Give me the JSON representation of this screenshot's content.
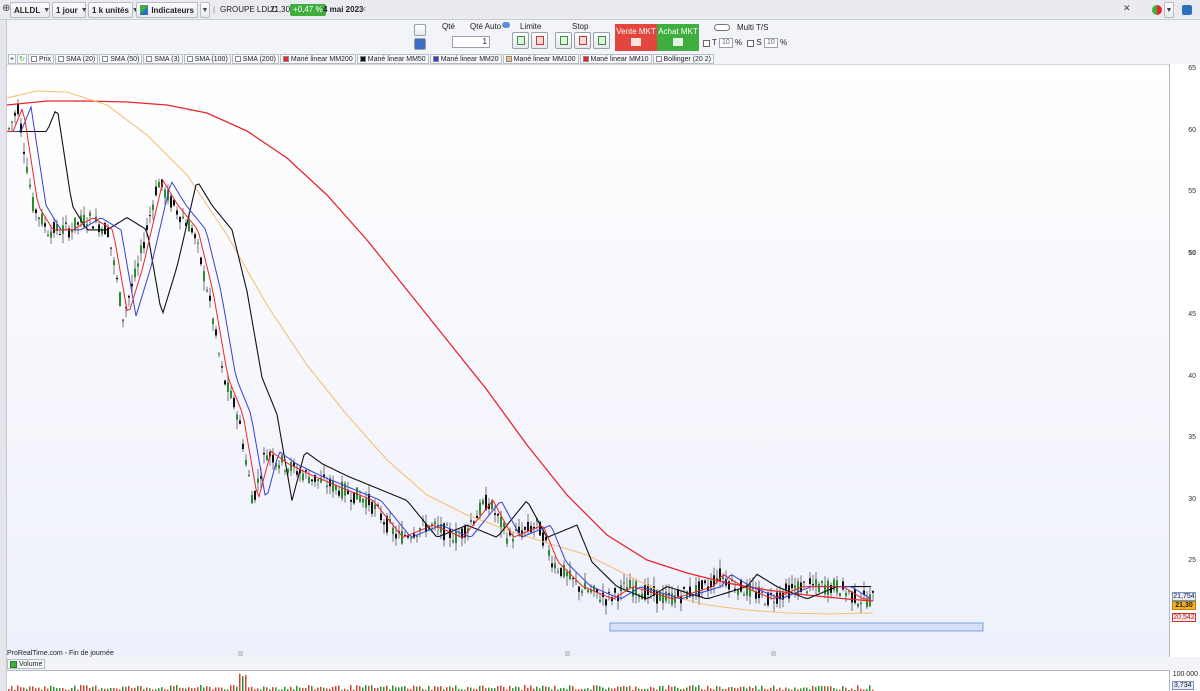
{
  "toolbar": {
    "symbol": "ALLDL",
    "timeframe": "1 jour",
    "units": "1 k unités",
    "indicators_label": "Indicateurs",
    "instrument_name": "GROUPE LDLC",
    "last_price": "21,30",
    "change_pct": "+0,47 %",
    "date": "4 mai 2023"
  },
  "order_panel": {
    "qty_label": "Qté",
    "qty_auto_label": "Qté Auto",
    "qty_value": "1",
    "limit_label": "Limite",
    "stop_label": "Stop",
    "sell_label": "Vente MKT",
    "buy_label": "Achat MKT",
    "multi_label": "Multi T/S",
    "t_label": "T",
    "t_value": "10",
    "s_label": "S",
    "s_value": "10",
    "pct": "%"
  },
  "legend": [
    {
      "label": "Prix",
      "color": "#ffffff"
    },
    {
      "label": "SMA (20)",
      "color": "#ffffff"
    },
    {
      "label": "SMA (50)",
      "color": "#ffffff"
    },
    {
      "label": "SMA (3)",
      "color": "#ffffff"
    },
    {
      "label": "SMA (100)",
      "color": "#ffffff"
    },
    {
      "label": "SMA (200)",
      "color": "#ffffff"
    },
    {
      "label": "Mané linear MM200",
      "color": "#e8262b"
    },
    {
      "label": "Mané linear MM50",
      "color": "#111111"
    },
    {
      "label": "Mané linear MM20",
      "color": "#3a3fd0"
    },
    {
      "label": "Mané linear MM100",
      "color": "#f3c274"
    },
    {
      "label": "Mané linear MM10",
      "color": "#e8262b"
    },
    {
      "label": "Bollinger (20 2)",
      "color": "#ffffff"
    }
  ],
  "axis": {
    "ticks": [
      "65",
      "60",
      "55",
      "50",
      "45",
      "40",
      "35",
      "30",
      "25"
    ],
    "bold_tick": "50",
    "tags": [
      "21,754",
      "21,30",
      "20,542"
    ]
  },
  "footer": {
    "source": "ProRealTime.com - Fin de journée",
    "volume_label": "Volume",
    "volume_axis": "100 000",
    "volume_value": "3,734"
  },
  "colors": {
    "ma200": "#e8262b",
    "ma100": "#f3c274",
    "ma50": "#111111",
    "ma20": "#3a3fd0",
    "ma10": "#e8262b",
    "candle_up": "#2e8b2e",
    "candle_down": "#111111",
    "support_box": "#7aa2e0"
  }
}
